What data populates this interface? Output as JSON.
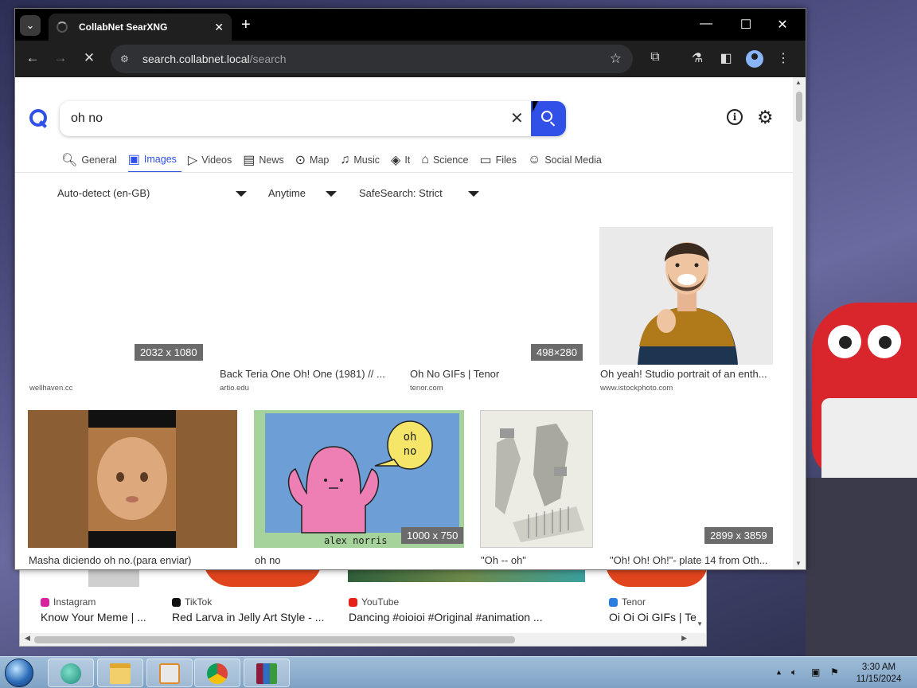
{
  "browser": {
    "tab_title": "CollabNet SearXNG",
    "url_host": "search.collabnet.local",
    "url_path": "/search"
  },
  "search": {
    "query": "oh no"
  },
  "categories": [
    {
      "label": "General",
      "icon": "search-icon",
      "glyph": "🔍︎"
    },
    {
      "label": "Images",
      "icon": "image-icon",
      "glyph": "▣"
    },
    {
      "label": "Videos",
      "icon": "play-icon",
      "glyph": "▷"
    },
    {
      "label": "News",
      "icon": "newspaper-icon",
      "glyph": "▤"
    },
    {
      "label": "Map",
      "icon": "map-pin-icon",
      "glyph": "⊙"
    },
    {
      "label": "Music",
      "icon": "music-note-icon",
      "glyph": "♫"
    },
    {
      "label": "It",
      "icon": "layers-icon",
      "glyph": "◈"
    },
    {
      "label": "Science",
      "icon": "graduation-cap-icon",
      "glyph": "⌂"
    },
    {
      "label": "Files",
      "icon": "archive-icon",
      "glyph": "▭"
    },
    {
      "label": "Social Media",
      "icon": "people-icon",
      "glyph": "☺"
    }
  ],
  "active_category": "Images",
  "filters": {
    "language": "Auto-detect (en-GB)",
    "time": "Anytime",
    "safesearch": "SafeSearch: Strict"
  },
  "results": [
    {
      "title": "",
      "source": "wellhaven.cc",
      "dimensions": "2032 x 1080"
    },
    {
      "title": "Back Teria One Oh! One (1981) // ...",
      "source": "artio.edu",
      "dimensions": ""
    },
    {
      "title": "Oh No GIFs | Tenor",
      "source": "tenor.com",
      "dimensions": "498×280"
    },
    {
      "title": "Oh yeah! Studio portrait of an enth...",
      "source": "www.istockphoto.com",
      "dimensions": ""
    },
    {
      "title": "Masha diciendo oh no.(para enviar)",
      "source": "",
      "dimensions": ""
    },
    {
      "title": "oh no",
      "source": "",
      "dimensions": "1000 x 750",
      "image_text": [
        "oh",
        "no",
        "alex norris"
      ]
    },
    {
      "title": "\"Oh -- oh\"",
      "source": "",
      "dimensions": ""
    },
    {
      "title": "\"Oh! Oh! Oh!\"- plate 14 from Oth...",
      "source": "",
      "dimensions": "2899 x 3859"
    }
  ],
  "back_window": {
    "cards": [
      {
        "source": "Instagram",
        "title": "Know Your Meme | ...",
        "color": "#d6249f"
      },
      {
        "source": "TikTok",
        "title": "Red Larva in Jelly Art Style - ...",
        "color": "#111111"
      },
      {
        "source": "YouTube",
        "title": "Dancing #oioioi #Original #animation ...",
        "color": "#e62117"
      },
      {
        "source": "Tenor",
        "title": "Oi Oi Oi GIFs | Te",
        "color": "#2a7de1"
      }
    ]
  },
  "taskbar": {
    "time": "3:30 AM",
    "date": "11/15/2024"
  },
  "colors": {
    "accent": "#3050e8",
    "chrome_dark": "#1f1f1f"
  }
}
